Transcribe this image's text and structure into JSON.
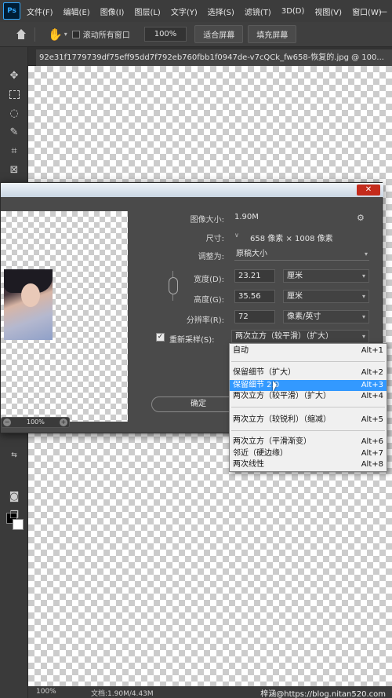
{
  "app": {
    "logo": "Ps"
  },
  "menu": [
    "文件(F)",
    "编辑(E)",
    "图像(I)",
    "图层(L)",
    "文字(Y)",
    "选择(S)",
    "滤镜(T)",
    "3D(D)",
    "视图(V)",
    "窗口(W)"
  ],
  "window_controls": "—",
  "options": {
    "scroll_all_label": "滚动所有窗口",
    "zoom_value": "100%",
    "fit_screen_label": "适合屏幕",
    "fill_screen_label": "填充屏幕"
  },
  "document": {
    "tab_title": "92e31f1779739df75eff95dd7f792eb760fbb1f0947de-v7cQCk_fw658-恢复的.jpg @ 100..."
  },
  "status": {
    "zoom": "100%",
    "doc_info": "文档:1.90M/4.43M",
    "watermark": "梓涵@https://blog.nitan520.com"
  },
  "dialog": {
    "close_label": "✕",
    "image_size_label": "图像大小:",
    "image_size_value": "1.90M",
    "dimensions_label": "尺寸:",
    "dimensions_value": "658 像素 × 1008 像素",
    "fit_to_label": "调整为:",
    "fit_to_value": "原稿大小",
    "width_label": "宽度(D):",
    "width_value": "23.21",
    "width_unit": "厘米",
    "height_label": "高度(G):",
    "height_value": "35.56",
    "height_unit": "厘米",
    "resolution_label": "分辨率(R):",
    "resolution_value": "72",
    "resolution_unit": "像素/英寸",
    "resample_label": "重新采样(S):",
    "resample_value": "两次立方（较平滑）（扩大）",
    "resample_checked": "✓",
    "ok_label": "确定",
    "preview_zoom": "100%"
  },
  "resample_options": [
    {
      "label": "自动",
      "shortcut": "Alt+1"
    },
    {
      "label": "保留细节（扩大）",
      "shortcut": "Alt+2"
    },
    {
      "label": "保留细节 2.0",
      "shortcut": "Alt+3",
      "selected": true
    },
    {
      "label": "两次立方（较平滑）（扩大）",
      "shortcut": "Alt+4"
    },
    {
      "label": "两次立方（较锐利）（缩减）",
      "shortcut": "Alt+5"
    },
    {
      "label": "两次立方（平滑渐变）",
      "shortcut": "Alt+6"
    },
    {
      "label": "邻近（硬边缘）",
      "shortcut": "Alt+7"
    },
    {
      "label": "两次线性",
      "shortcut": "Alt+8"
    }
  ],
  "tools": [
    "move-icon",
    "marquee-icon",
    "lasso-icon",
    "quick-select-icon",
    "crop-icon",
    "frame-icon",
    "eyedropper-icon"
  ],
  "colors": {
    "foreground": "#000000",
    "background": "#ffffff",
    "highlight": "#3399ff",
    "close_red": "#c42b1c"
  }
}
